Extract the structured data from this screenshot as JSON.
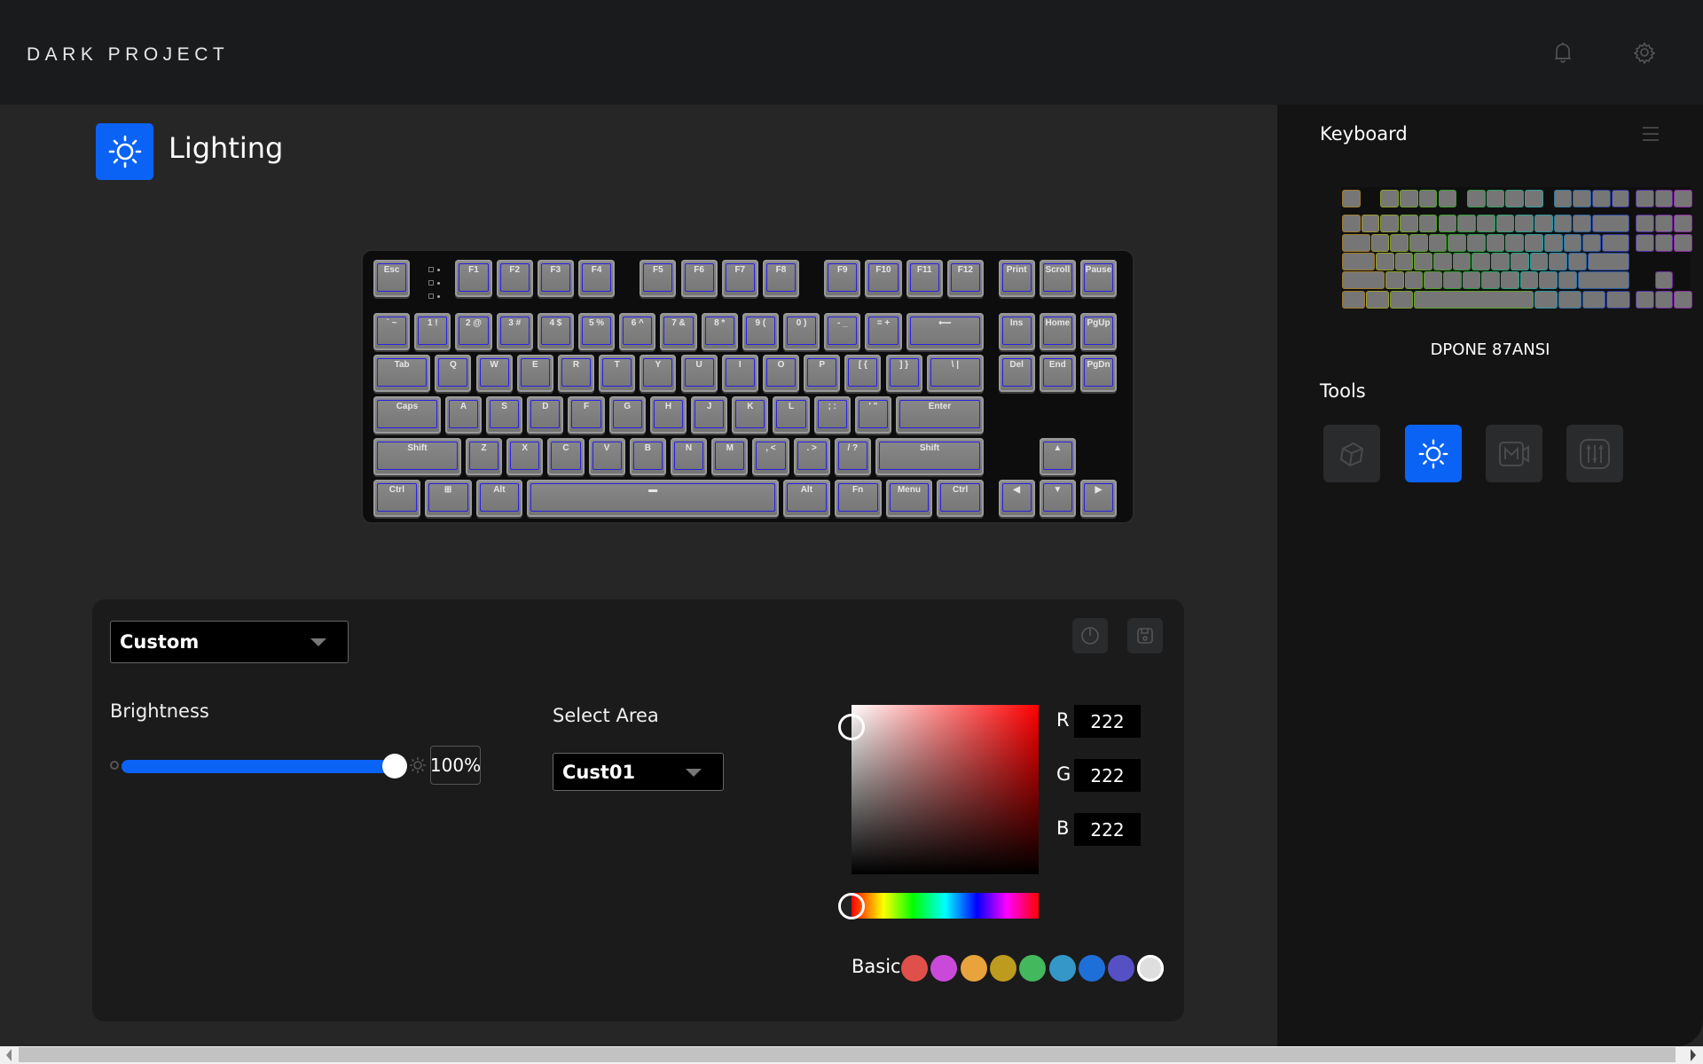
{
  "header": {
    "logo": "DARK PROJECT",
    "icons": [
      "bell-icon",
      "gear-icon"
    ]
  },
  "page": {
    "title": "Lighting",
    "icon": "sun-icon"
  },
  "keyboard": {
    "rows": [
      [
        {
          "l": "Esc"
        },
        {
          "l": "F1"
        },
        {
          "l": "F2"
        },
        {
          "l": "F3"
        },
        {
          "l": "F4"
        },
        {
          "l": "F5"
        },
        {
          "l": "F6"
        },
        {
          "l": "F7"
        },
        {
          "l": "F8"
        },
        {
          "l": "F9"
        },
        {
          "l": "F10"
        },
        {
          "l": "F11"
        },
        {
          "l": "F12"
        },
        {
          "l": "Print"
        },
        {
          "l": "Scroll"
        },
        {
          "l": "Pause"
        }
      ],
      [
        {
          "l": "` ~"
        },
        {
          "l": "1 !"
        },
        {
          "l": "2 @"
        },
        {
          "l": "3 #"
        },
        {
          "l": "4 $"
        },
        {
          "l": "5 %"
        },
        {
          "l": "6 ^"
        },
        {
          "l": "7 &"
        },
        {
          "l": "8 *"
        },
        {
          "l": "9 ("
        },
        {
          "l": "0 )"
        },
        {
          "l": "- _"
        },
        {
          "l": "= +"
        },
        {
          "l": "⟵"
        },
        {
          "l": "Ins"
        },
        {
          "l": "Home"
        },
        {
          "l": "PgUp"
        }
      ],
      [
        {
          "l": "Tab"
        },
        {
          "l": "Q"
        },
        {
          "l": "W"
        },
        {
          "l": "E"
        },
        {
          "l": "R"
        },
        {
          "l": "T"
        },
        {
          "l": "Y"
        },
        {
          "l": "U"
        },
        {
          "l": "I"
        },
        {
          "l": "O"
        },
        {
          "l": "P"
        },
        {
          "l": "[ {"
        },
        {
          "l": "] }"
        },
        {
          "l": "\\ |"
        },
        {
          "l": "Del"
        },
        {
          "l": "End"
        },
        {
          "l": "PgDn"
        }
      ],
      [
        {
          "l": "Caps"
        },
        {
          "l": "A"
        },
        {
          "l": "S"
        },
        {
          "l": "D"
        },
        {
          "l": "F"
        },
        {
          "l": "G"
        },
        {
          "l": "H"
        },
        {
          "l": "J"
        },
        {
          "l": "K"
        },
        {
          "l": "L"
        },
        {
          "l": "; :"
        },
        {
          "l": "' \""
        },
        {
          "l": "Enter"
        }
      ],
      [
        {
          "l": "Shift"
        },
        {
          "l": "Z"
        },
        {
          "l": "X"
        },
        {
          "l": "C"
        },
        {
          "l": "V"
        },
        {
          "l": "B"
        },
        {
          "l": "N"
        },
        {
          "l": "M"
        },
        {
          "l": ", <"
        },
        {
          "l": ". >"
        },
        {
          "l": "/ ?"
        },
        {
          "l": "Shift"
        },
        {
          "l": "▲"
        }
      ],
      [
        {
          "l": "Ctrl"
        },
        {
          "l": "⊞"
        },
        {
          "l": "Alt"
        },
        {
          "l": "▬"
        },
        {
          "l": "Alt"
        },
        {
          "l": "Fn"
        },
        {
          "l": "Menu"
        },
        {
          "l": "Ctrl"
        },
        {
          "l": "◀"
        },
        {
          "l": "▼"
        },
        {
          "l": "▶"
        }
      ]
    ]
  },
  "controls": {
    "effect_dropdown": "Custom",
    "brightness_label": "Brightness",
    "brightness_value": "100%",
    "brightness_fraction": 1.0,
    "select_area_label": "Select Area",
    "area_dropdown": "Cust01",
    "action_buttons": [
      "power-icon",
      "save-icon"
    ]
  },
  "color_picker": {
    "rgb": [
      {
        "label": "R",
        "value": "222"
      },
      {
        "label": "G",
        "value": "222"
      },
      {
        "label": "B",
        "value": "222"
      }
    ],
    "hue_color": "#ff0000",
    "basic_label": "Basic",
    "swatches": [
      "#e0504a",
      "#c94ad8",
      "#e8a33c",
      "#bd9b1e",
      "#44b85c",
      "#3497c8",
      "#1f6fd8",
      "#5551c5",
      "#dedede"
    ],
    "selected_swatch": 8
  },
  "sidebar": {
    "keyboard_title": "Keyboard",
    "model_name": "DPONE 87ANSI",
    "tools_title": "Tools",
    "tools": [
      {
        "name": "keycap",
        "icon": "keycap-icon",
        "active": false
      },
      {
        "name": "lighting",
        "icon": "sun-icon",
        "active": true
      },
      {
        "name": "macro",
        "icon": "macro-icon",
        "active": false
      },
      {
        "name": "performance",
        "icon": "sliders-icon",
        "active": false
      }
    ]
  }
}
